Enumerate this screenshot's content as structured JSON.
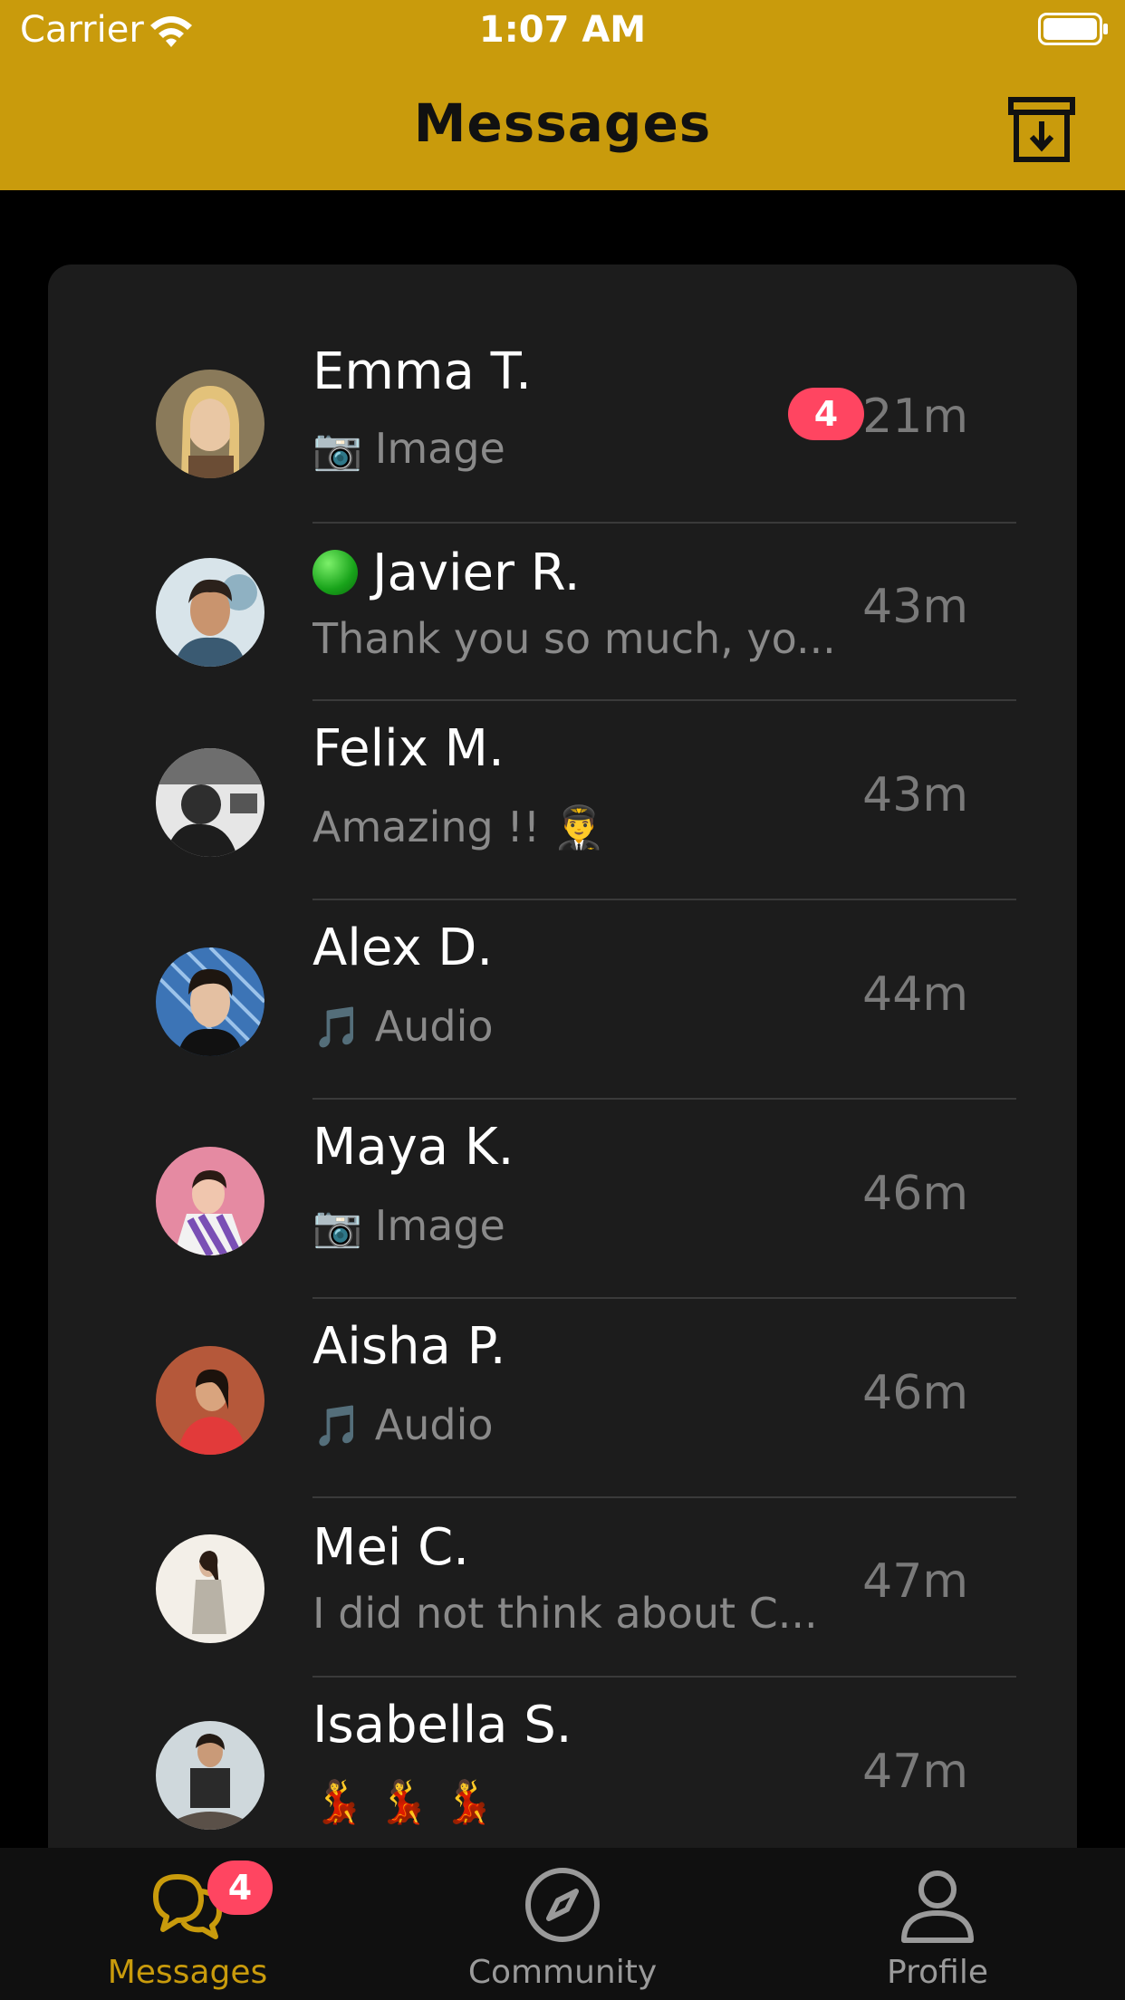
{
  "status_bar": {
    "carrier": "Carrier",
    "time": "1:07 AM"
  },
  "header": {
    "title": "Messages",
    "archive_icon": "archive-download-icon"
  },
  "colors": {
    "accent": "#c99b0c",
    "card": "#1c1c1c",
    "badge": "#ff4561",
    "online": "#18a31a"
  },
  "chats": [
    {
      "name": "Emma T.",
      "preview_icon": "📷",
      "preview": "Image",
      "time": "21m",
      "unread": "4",
      "online": false
    },
    {
      "name": "Javier R.",
      "preview_icon": "",
      "preview": "Thank you so much, yo...",
      "time": "43m",
      "unread": "",
      "online": true
    },
    {
      "name": "Felix M.",
      "preview_icon": "",
      "preview": "Amazing !! 👨‍✈️",
      "time": "43m",
      "unread": "",
      "online": false
    },
    {
      "name": "Alex D.",
      "preview_icon": "🎵",
      "preview": "Audio",
      "time": "44m",
      "unread": "",
      "online": false
    },
    {
      "name": "Maya K.",
      "preview_icon": "📷",
      "preview": "Image",
      "time": "46m",
      "unread": "",
      "online": false
    },
    {
      "name": "Aisha P.",
      "preview_icon": "🎵",
      "preview": "Audio",
      "time": "46m",
      "unread": "",
      "online": false
    },
    {
      "name": "Mei C.",
      "preview_icon": "",
      "preview": "I did not think about C...",
      "time": "47m",
      "unread": "",
      "online": false
    },
    {
      "name": "Isabella S.",
      "preview_icon": "",
      "preview": "💃 💃 💃",
      "time": "47m",
      "unread": "",
      "online": false
    }
  ],
  "tabs": [
    {
      "label": "Messages",
      "icon": "chat-bubbles-icon",
      "badge": "4",
      "active": true
    },
    {
      "label": "Community",
      "icon": "compass-icon",
      "badge": "",
      "active": false
    },
    {
      "label": "Profile",
      "icon": "person-icon",
      "badge": "",
      "active": false
    }
  ]
}
